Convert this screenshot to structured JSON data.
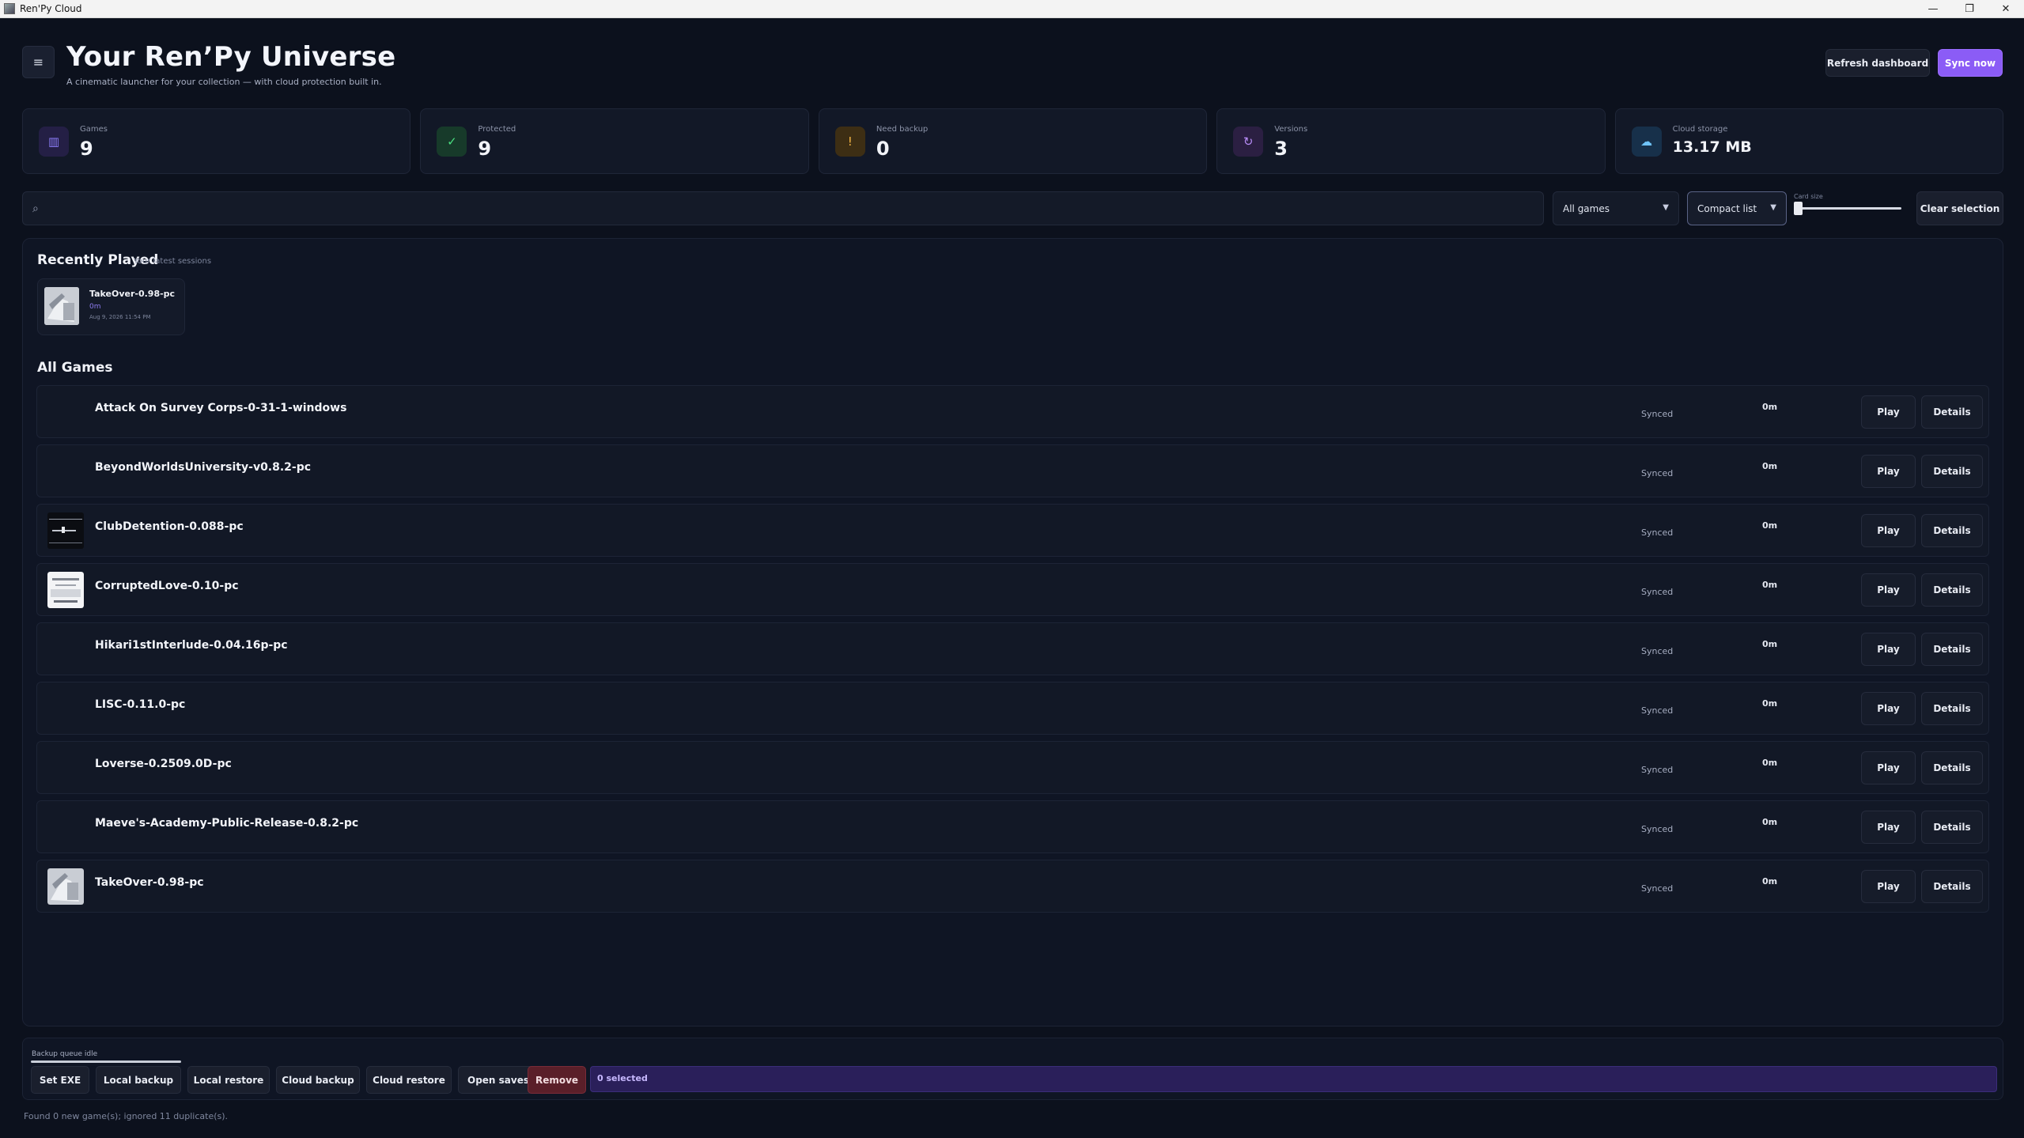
{
  "window": {
    "title": "Ren'Py Cloud",
    "controls": {
      "minimize": "—",
      "maximize": "❐",
      "close": "✕"
    }
  },
  "header": {
    "menu_icon": "≡",
    "title": "Your Ren’Py Universe",
    "subtitle": "A cinematic launcher for your collection — with cloud protection built in.",
    "refresh_label": "Refresh dashboard",
    "sync_label": "Sync now"
  },
  "stats": [
    {
      "label": "Games",
      "value": "9",
      "icon": "library-icon",
      "glyph": "▥",
      "color": "#8b7cf6",
      "bg": "#241f45"
    },
    {
      "label": "Protected",
      "value": "9",
      "icon": "check-icon",
      "glyph": "✓",
      "color": "#4ade80",
      "bg": "#173a2a"
    },
    {
      "label": "Need backup",
      "value": "0",
      "icon": "warning-icon",
      "glyph": "!",
      "color": "#f5b544",
      "bg": "#3d2e14"
    },
    {
      "label": "Versions",
      "value": "3",
      "icon": "history-icon",
      "glyph": "↻",
      "color": "#b78cf7",
      "bg": "#2b1f42"
    },
    {
      "label": "Cloud storage",
      "value": "13.17 MB",
      "icon": "cloud-icon",
      "glyph": "☁",
      "color": "#6fc3f7",
      "bg": "#17304a"
    }
  ],
  "toolbar": {
    "search_placeholder": "",
    "search_value": "",
    "filter_value": "All games",
    "view_value": "Compact list",
    "card_size_label": "Card size",
    "card_size": 0,
    "clear_label": "Clear selection"
  },
  "recent": {
    "title": "Recently Played",
    "hint": "Your latest sessions",
    "items": [
      {
        "name": "TakeOver-0.98-pc",
        "time": "0m",
        "date": "Aug 9, 2026 11:54 PM"
      }
    ]
  },
  "all_games": {
    "title": "All Games",
    "play_label": "Play",
    "details_label": "Details",
    "items": [
      {
        "name": "Attack On Survey Corps-0-31-1-windows",
        "status": "Synced",
        "time": "0m",
        "thumb": "none"
      },
      {
        "name": "BeyondWorldsUniversity-v0.8.2-pc",
        "status": "Synced",
        "time": "0m",
        "thumb": "none"
      },
      {
        "name": "ClubDetention-0.088-pc",
        "status": "Synced",
        "time": "0m",
        "thumb": "dark"
      },
      {
        "name": "CorruptedLove-0.10-pc",
        "status": "Synced",
        "time": "0m",
        "thumb": "light"
      },
      {
        "name": "Hikari1stInterlude-0.04.16p-pc",
        "status": "Synced",
        "time": "0m",
        "thumb": "none"
      },
      {
        "name": "LISC-0.11.0-pc",
        "status": "Synced",
        "time": "0m",
        "thumb": "none"
      },
      {
        "name": "Loverse-0.2509.0D-pc",
        "status": "Synced",
        "time": "0m",
        "thumb": "none"
      },
      {
        "name": "Maeve's-Academy-Public-Release-0.8.2-pc",
        "status": "Synced",
        "time": "0m",
        "thumb": "none"
      },
      {
        "name": "TakeOver-0.98-pc",
        "status": "Synced",
        "time": "0m",
        "thumb": "takeover"
      }
    ]
  },
  "bottom": {
    "queue_label": "Backup queue idle",
    "queue_progress": 1,
    "buttons": [
      "Set EXE",
      "Local backup",
      "Local restore",
      "Cloud backup",
      "Cloud restore",
      "Open saves",
      "Remove"
    ],
    "selected_text": "0 selected"
  },
  "footer_status": "Found 0 new game(s); ignored 11 duplicate(s)."
}
